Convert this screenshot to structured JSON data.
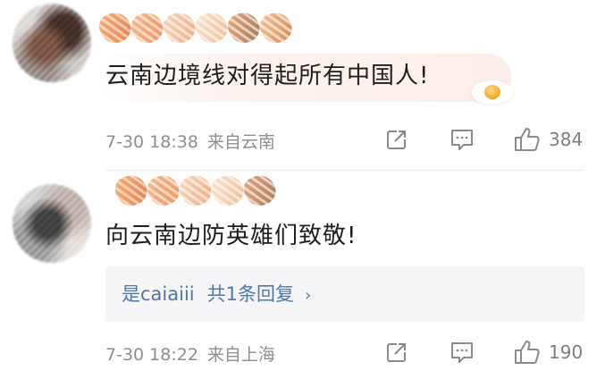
{
  "comments": [
    {
      "text": "云南边境线对得起所有中国人!",
      "time": "7-30 18:38",
      "location": "来自云南",
      "likes": "384",
      "icons": {
        "share": "share-icon",
        "reply": "comment-icon",
        "like": "thumbs-up-icon"
      }
    },
    {
      "text": "向云南边防英雄们致敬!",
      "reply_summary": {
        "user": "是caiaiii",
        "count_text": "共1条回复",
        "chevron": "›"
      },
      "time": "7-30 18:22",
      "location": "来自上海",
      "likes": "190",
      "icons": {
        "share": "share-icon",
        "reply": "comment-icon",
        "like": "thumbs-up-icon"
      }
    }
  ],
  "colors": {
    "link": "#4f78a8",
    "meta": "#8e8e8e",
    "text": "#1e1e1e",
    "reply_bg": "#f5f5f7"
  }
}
